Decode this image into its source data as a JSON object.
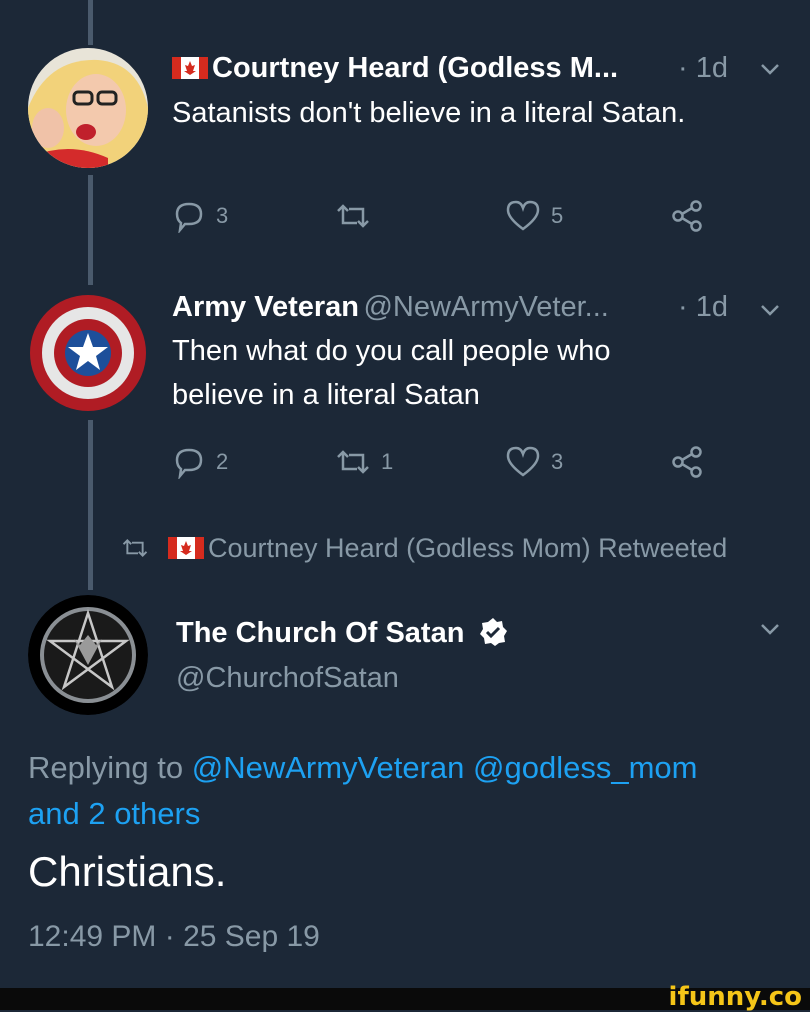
{
  "tweet1": {
    "name": "Courtney Heard (Godless M...",
    "time": "· 1d",
    "text": "Satanists don't believe in a literal Satan.",
    "reply_count": "3",
    "retweet_count": "",
    "like_count": "5"
  },
  "tweet2": {
    "name": "Army Veteran",
    "handle": "@NewArmyVeter...",
    "time": "· 1d",
    "text_line1": "Then what do you call people who",
    "text_line2": "believe in a literal Satan",
    "reply_count": "2",
    "retweet_count": "1",
    "like_count": "3"
  },
  "retweet_notice": "Courtney Heard (Godless Mom) Retweeted",
  "main_tweet": {
    "name": "The Church Of Satan",
    "handle": "@ChurchofSatan",
    "replying_prefix": "Replying to",
    "reply_mention1": "@NewArmyVeteran",
    "reply_mention2": "@godless_mom",
    "reply_others": "and 2 others",
    "text": "Christians.",
    "timestamp": "12:49 PM · 25 Sep 19"
  },
  "watermark": "ifunny.co",
  "colors": {
    "background": "#1c2837",
    "secondary_text": "#8899a6",
    "link": "#1da1f2",
    "thread_line": "#4a5a6c"
  }
}
